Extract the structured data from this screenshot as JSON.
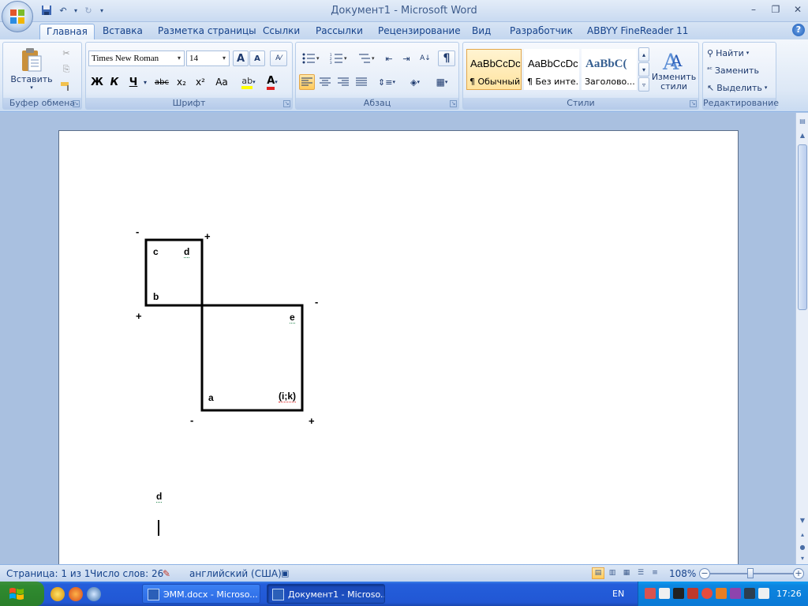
{
  "window": {
    "title": "Документ1 - Microsoft Word"
  },
  "qat": {
    "save_icon": "save-icon",
    "undo_icon": "undo-icon",
    "redo_icon": "redo-icon"
  },
  "tabs": [
    {
      "label": "Главная",
      "active": true
    },
    {
      "label": "Вставка"
    },
    {
      "label": "Разметка страницы"
    },
    {
      "label": "Ссылки"
    },
    {
      "label": "Рассылки"
    },
    {
      "label": "Рецензирование"
    },
    {
      "label": "Вид"
    },
    {
      "label": "Разработчик"
    },
    {
      "label": "ABBYY FineReader 11"
    }
  ],
  "ribbon": {
    "clipboard": {
      "label": "Буфер обмена",
      "paste": "Вставить"
    },
    "font": {
      "label": "Шрифт",
      "font_name": "Times New Roman",
      "font_size": "14",
      "bold": "Ж",
      "italic": "К",
      "underline": "Ч",
      "strike": "abc",
      "grow": "A",
      "shrink": "A",
      "subscript": "x₂",
      "superscript": "x²",
      "case": "Aa"
    },
    "paragraph": {
      "label": "Абзац",
      "pilcrow": "¶"
    },
    "styles": {
      "label": "Стили",
      "items": [
        {
          "sample": "AaBbCcDc",
          "name": "¶ Обычный",
          "selected": true
        },
        {
          "sample": "AaBbCcDc",
          "name": "¶ Без инте..."
        },
        {
          "sample": "AaBbC(",
          "name": "Заголово..."
        }
      ],
      "change_styles": "Изменить стили"
    },
    "editing": {
      "label": "Редактирование",
      "find": "Найти",
      "replace": "Заменить",
      "select": "Выделить"
    }
  },
  "document": {
    "labels": {
      "minus_tl": "-",
      "plus_tl": "+",
      "c": "c",
      "d": "d",
      "b": "b",
      "plus_bl": "+",
      "minus_r": "-",
      "e": "e",
      "a": "a",
      "ik": "(i;k)",
      "minus_bottom": "-",
      "plus_bottom": "+",
      "d_below": "d"
    }
  },
  "status": {
    "page": "Страница: 1 из 1",
    "words": "Число слов: 26",
    "language": "английский (США)",
    "zoom": "108%",
    "zoom_minus": "−",
    "zoom_plus": "+"
  },
  "taskbar": {
    "tasks": [
      {
        "label": "ЭММ.docx - Microso...",
        "active": false
      },
      {
        "label": "Документ1 - Microso...",
        "active": true
      }
    ],
    "lang": "EN",
    "time": "17:26"
  }
}
